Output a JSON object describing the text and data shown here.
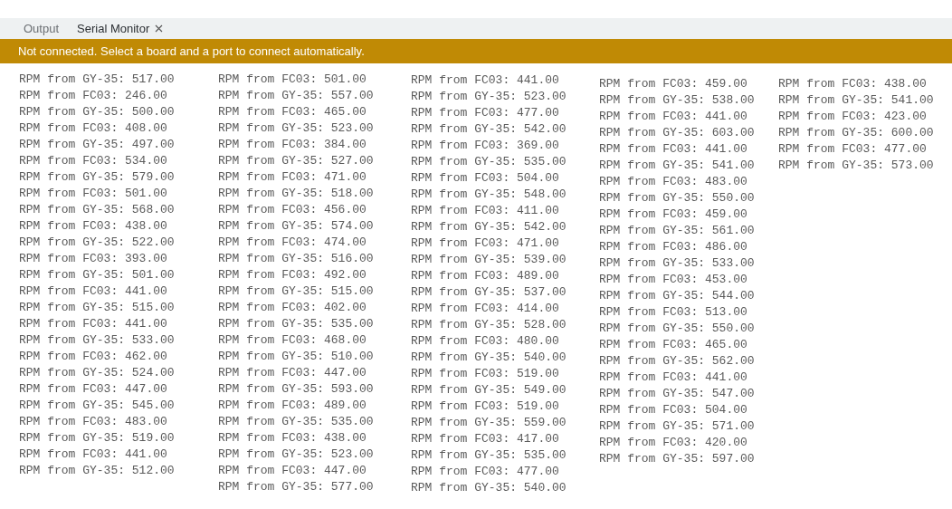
{
  "tabs": [
    {
      "label": "Output",
      "selected": false,
      "closable": false
    },
    {
      "label": "Serial Monitor",
      "selected": true,
      "closable": true
    }
  ],
  "banner": {
    "message": "Not connected. Select a board and a port to connect automatically."
  },
  "columns": [
    [
      "RPM from GY-35: 517.00",
      "RPM from FC03: 246.00",
      "RPM from GY-35: 500.00",
      "RPM from FC03: 408.00",
      "RPM from GY-35: 497.00",
      "RPM from FC03: 534.00",
      "RPM from GY-35: 579.00",
      "RPM from FC03: 501.00",
      "RPM from GY-35: 568.00",
      "RPM from FC03: 438.00",
      "RPM from GY-35: 522.00",
      "RPM from FC03: 393.00",
      "RPM from GY-35: 501.00",
      "RPM from FC03: 441.00",
      "RPM from GY-35: 515.00",
      "RPM from FC03: 441.00",
      "RPM from GY-35: 533.00",
      "RPM from FC03: 462.00",
      "RPM from GY-35: 524.00",
      "RPM from FC03: 447.00",
      "RPM from GY-35: 545.00",
      "RPM from FC03: 483.00",
      "RPM from GY-35: 519.00",
      "RPM from FC03: 441.00",
      "RPM from GY-35: 512.00"
    ],
    [
      "RPM from FC03: 501.00",
      "RPM from GY-35: 557.00",
      "RPM from FC03: 465.00",
      "RPM from GY-35: 523.00",
      "RPM from FC03: 384.00",
      "RPM from GY-35: 527.00",
      "RPM from FC03: 471.00",
      "RPM from GY-35: 518.00",
      "RPM from FC03: 456.00",
      "RPM from GY-35: 574.00",
      "RPM from FC03: 474.00",
      "RPM from GY-35: 516.00",
      "RPM from FC03: 492.00",
      "RPM from GY-35: 515.00",
      "RPM from FC03: 402.00",
      "RPM from GY-35: 535.00",
      "RPM from FC03: 468.00",
      "RPM from GY-35: 510.00",
      "RPM from FC03: 447.00",
      "RPM from GY-35: 593.00",
      "RPM from FC03: 489.00",
      "RPM from GY-35: 535.00",
      "RPM from FC03: 438.00",
      "RPM from GY-35: 523.00",
      "RPM from FC03: 447.00",
      "RPM from GY-35: 577.00"
    ],
    [
      "RPM from FC03: 441.00",
      "RPM from GY-35: 523.00",
      "RPM from FC03: 477.00",
      "RPM from GY-35: 542.00",
      "RPM from FC03: 369.00",
      "RPM from GY-35: 535.00",
      "RPM from FC03: 504.00",
      "RPM from GY-35: 548.00",
      "RPM from FC03: 411.00",
      "RPM from GY-35: 542.00",
      "RPM from FC03: 471.00",
      "RPM from GY-35: 539.00",
      "RPM from FC03: 489.00",
      "RPM from GY-35: 537.00",
      "RPM from FC03: 414.00",
      "RPM from GY-35: 528.00",
      "RPM from FC03: 480.00",
      "RPM from GY-35: 540.00",
      "RPM from FC03: 519.00",
      "RPM from GY-35: 549.00",
      "RPM from FC03: 519.00",
      "RPM from GY-35: 559.00",
      "RPM from FC03: 417.00",
      "RPM from GY-35: 535.00",
      "RPM from FC03: 477.00",
      "RPM from GY-35: 540.00"
    ],
    [
      "RPM from FC03: 459.00",
      "RPM from GY-35: 538.00",
      "RPM from FC03: 441.00",
      "RPM from GY-35: 603.00",
      "RPM from FC03: 441.00",
      "RPM from GY-35: 541.00",
      "RPM from FC03: 483.00",
      "RPM from GY-35: 550.00",
      "RPM from FC03: 459.00",
      "RPM from GY-35: 561.00",
      "RPM from FC03: 486.00",
      "RPM from GY-35: 533.00",
      "RPM from FC03: 453.00",
      "RPM from GY-35: 544.00",
      "RPM from FC03: 513.00",
      "RPM from GY-35: 550.00",
      "RPM from FC03: 465.00",
      "RPM from GY-35: 562.00",
      "RPM from FC03: 441.00",
      "RPM from GY-35: 547.00",
      "RPM from FC03: 504.00",
      "RPM from GY-35: 571.00",
      "RPM from FC03: 420.00",
      "RPM from GY-35: 597.00"
    ],
    [
      "RPM from FC03: 438.00",
      "RPM from GY-35: 541.00",
      "RPM from FC03: 423.00",
      "RPM from GY-35: 600.00",
      "RPM from FC03: 477.00",
      "RPM from GY-35: 573.00"
    ]
  ]
}
